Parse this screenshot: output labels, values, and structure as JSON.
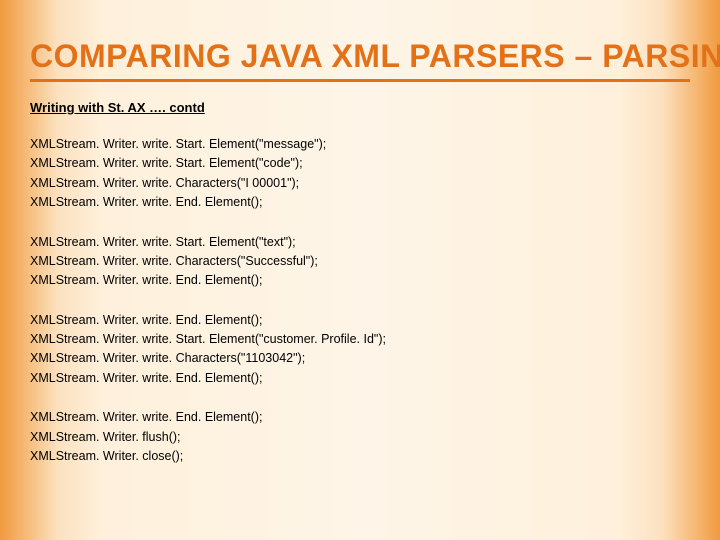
{
  "title": "COMPARING JAVA XML PARSERS – PARSING XML",
  "subtitle": "Writing with St. AX …. contd",
  "blocks": [
    [
      "XMLStream. Writer. write. Start. Element(\"message\");",
      "XMLStream. Writer. write. Start. Element(\"code\");",
      "XMLStream. Writer. write. Characters(\"I 00001\");",
      "XMLStream. Writer. write. End. Element();"
    ],
    [
      "XMLStream. Writer. write. Start. Element(\"text\");",
      "XMLStream. Writer. write. Characters(\"Successful\");",
      "XMLStream. Writer. write. End. Element();"
    ],
    [
      "XMLStream. Writer. write. End. Element();",
      "XMLStream. Writer. write. Start. Element(\"customer. Profile. Id\");",
      "XMLStream. Writer. write. Characters(\"1103042\");",
      "XMLStream. Writer. write. End. Element();"
    ],
    [
      "XMLStream. Writer. write. End. Element();",
      "XMLStream. Writer. flush();",
      "XMLStream. Writer. close();"
    ]
  ]
}
